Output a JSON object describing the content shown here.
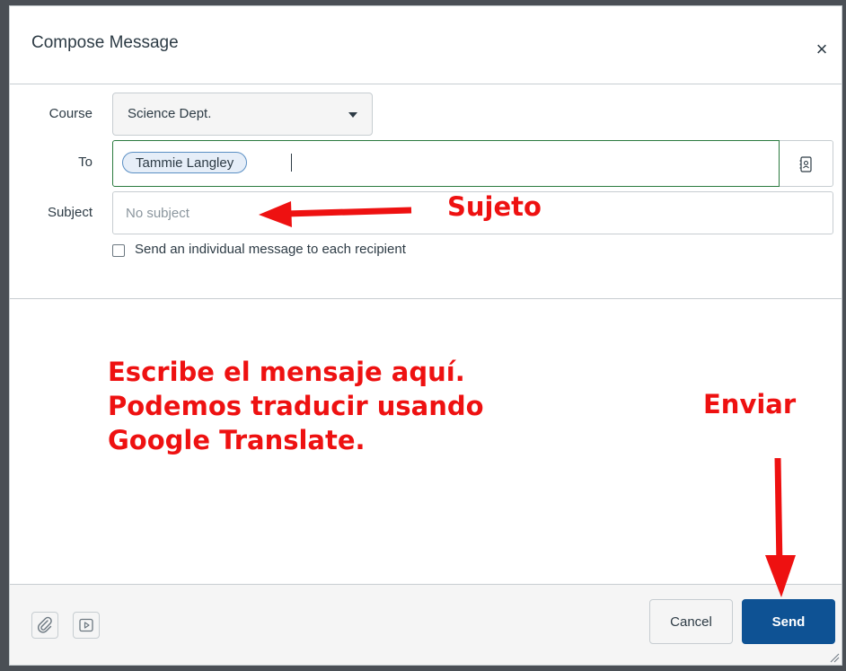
{
  "dialog": {
    "title": "Compose Message",
    "close_glyph": "×"
  },
  "form": {
    "course_label": "Course",
    "course_value": "Science Dept.",
    "to_label": "To",
    "recipient": "Tammie Langley",
    "subject_label": "Subject",
    "subject_placeholder": "No subject",
    "subject_value": "",
    "individual_message_label": "Send an individual message to each recipient",
    "individual_message_checked": false
  },
  "footer": {
    "attach_icon": "paperclip-icon",
    "media_icon": "media-play-icon",
    "cancel_label": "Cancel",
    "send_label": "Send"
  },
  "annotations": {
    "subject_note": "Sujeto",
    "message_note_lines": [
      "Escribe el mensaje aquí.",
      "Podemos traducir usando",
      "Google Translate."
    ],
    "send_note": "Enviar",
    "color": "#ee1111"
  },
  "colors": {
    "send_button": "#0e5294",
    "to_field_border": "#2b7a3f",
    "token_border": "#5a8fc4"
  }
}
